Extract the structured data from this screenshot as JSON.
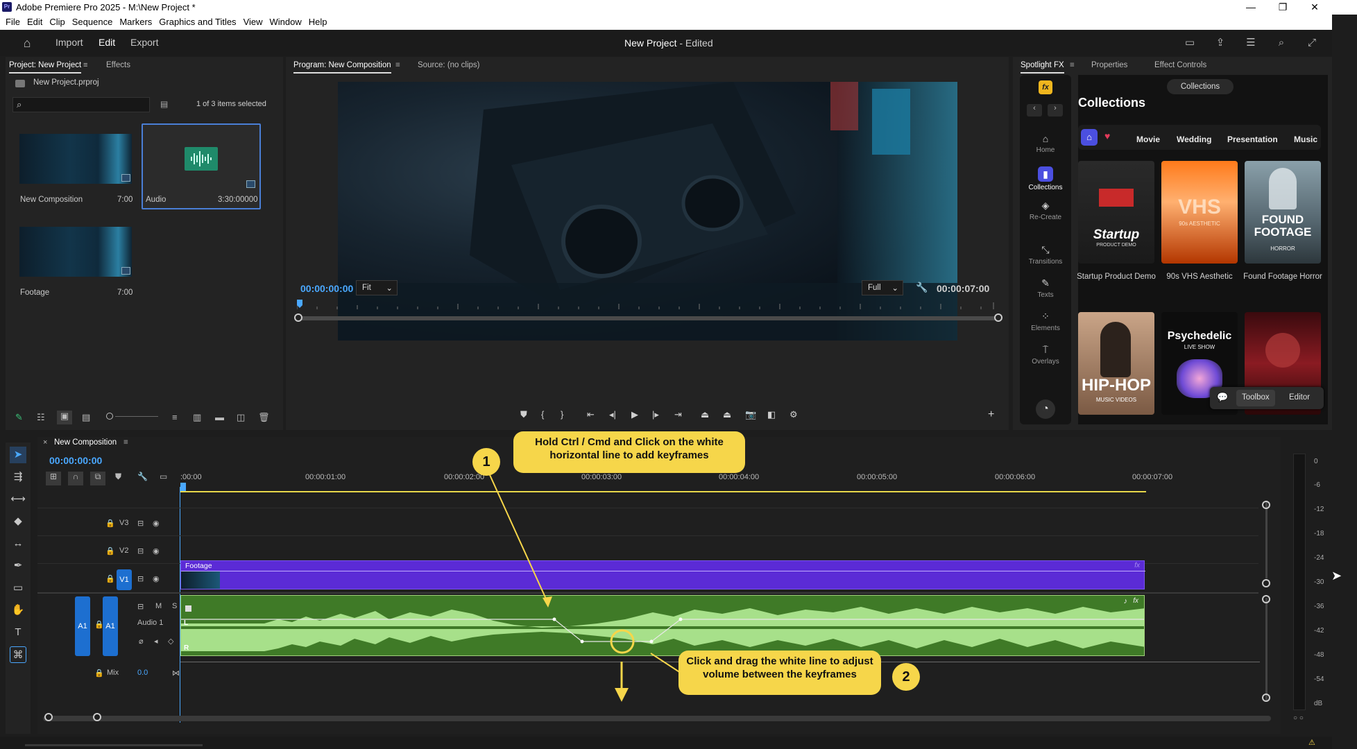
{
  "window": {
    "title": "Adobe Premiere Pro 2025 - M:\\New Project *",
    "app_badge": "Pr",
    "controls": {
      "minimize": "—",
      "maximize": "❐",
      "close": "✕"
    }
  },
  "menu": [
    "File",
    "Edit",
    "Clip",
    "Sequence",
    "Markers",
    "Graphics and Titles",
    "View",
    "Window",
    "Help"
  ],
  "header": {
    "nav": {
      "import": "Import",
      "edit": "Edit",
      "export": "Export"
    },
    "project_title": "New Project",
    "project_state": "- Edited"
  },
  "project_panel": {
    "tabs": {
      "project": "Project: New Project",
      "effects": "Effects"
    },
    "file": "New Project.prproj",
    "search_placeholder": "",
    "selection": "1 of 3 items selected",
    "items": [
      {
        "name": "New Composition",
        "duration": "7:00"
      },
      {
        "name": "Audio",
        "duration": "3:30:00000"
      },
      {
        "name": "Footage",
        "duration": "7:00"
      }
    ]
  },
  "program_panel": {
    "tabs": {
      "program": "Program: New Composition",
      "source": "Source: (no clips)"
    },
    "timecode_in": "00:00:00:00",
    "fit": "Fit",
    "quality": "Full",
    "timecode_out": "00:00:07:00"
  },
  "spotlight": {
    "tabs": {
      "spotlight": "Spotlight FX",
      "properties": "Properties",
      "effect_controls": "Effect Controls"
    },
    "logo": "fx",
    "side": {
      "home": "Home",
      "collections": "Collections",
      "recreate": "Re-Create",
      "transitions": "Transitions",
      "texts": "Texts",
      "elements": "Elements",
      "overlays": "Overlays"
    },
    "collections_pill": "Collections",
    "heading": "Collections",
    "categories": {
      "movie": "Movie",
      "wedding": "Wedding",
      "presentation": "Presentation",
      "music": "Music"
    },
    "cards": [
      {
        "art": "Startup",
        "art_sub": "PRODUCT DEMO",
        "caption": "Startup Product Demo"
      },
      {
        "art": "VHS",
        "art_sub": "90s AESTHETIC",
        "caption": "90s VHS Aesthetic"
      },
      {
        "art": "FOUND FOOTAGE",
        "art_sub": "HORROR",
        "caption": "Found Footage Horror"
      },
      {
        "art": "HIP-HOP",
        "art_sub": "MUSIC VIDEOS",
        "caption": ""
      },
      {
        "art": "Psychedelic",
        "art_sub": "LIVE SHOW",
        "caption": ""
      },
      {
        "art": "",
        "art_sub": "",
        "caption": ""
      }
    ],
    "toolbox": "Toolbox",
    "editor": "Editor"
  },
  "timeline": {
    "sequence_name": "New Composition",
    "timecode": "00:00:00:00",
    "ruler": [
      ":00:00",
      "00:00:01:00",
      "00:00:02:00",
      "00:00:03:00",
      "00:00:04:00",
      "00:00:05:00",
      "00:00:06:00",
      "00:00:07:00"
    ],
    "tracks": {
      "v3": "V3",
      "v2": "V2",
      "v1": "V1",
      "a1_source": "A1",
      "a1": "A1",
      "audio_name": "Audio 1",
      "mute": "M",
      "solo": "S",
      "mix": "Mix",
      "mix_value": "0.0"
    },
    "clip_footage": "Footage",
    "clip_markers": {
      "left": "L",
      "right": "R",
      "fx": "fx"
    }
  },
  "callouts": {
    "one_num": "1",
    "one_text": "Hold Ctrl / Cmd and Click on the white horizontal line to add keyframes",
    "two_num": "2",
    "two_text": "Click and drag the white line to adjust volume between the keyframes"
  },
  "meter": {
    "scale": [
      "0",
      "-6",
      "-12",
      "-18",
      "-24",
      "-30",
      "-36",
      "-42",
      "-48",
      "-54",
      "dB"
    ]
  },
  "colors": {
    "accent_blue": "#4aa8ff",
    "video_clip": "#5b2bd6",
    "audio_clip": "#3f7a27",
    "audio_wave": "#a7e08a",
    "callout": "#f6d64a",
    "timeline_yellow": "#e8d84a"
  }
}
